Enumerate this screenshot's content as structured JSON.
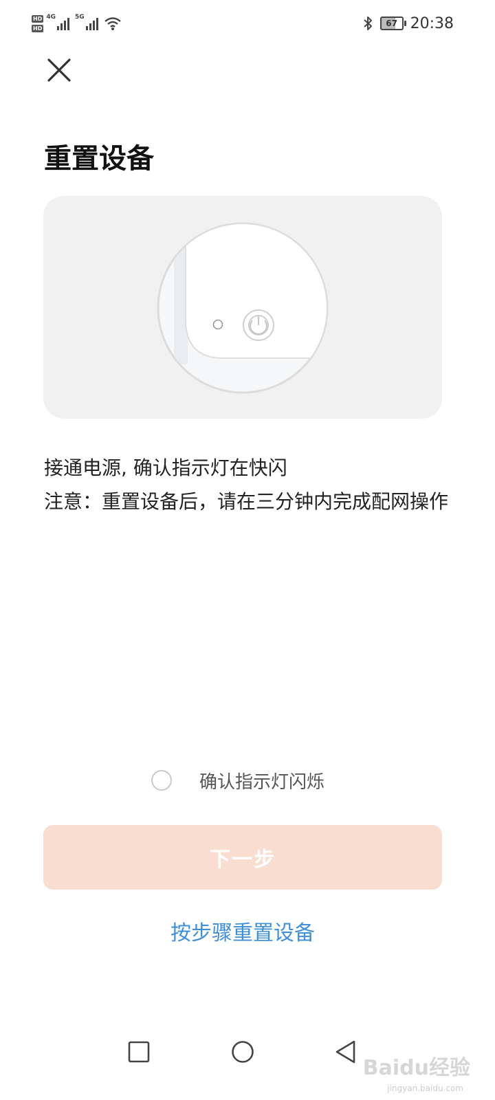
{
  "status_bar": {
    "hd1": "HD",
    "hd2": "HD",
    "net1": "4G",
    "net2": "5G",
    "battery": "67",
    "time": "20:38"
  },
  "page": {
    "title": "重置设备",
    "close_icon": "close-icon"
  },
  "instructions": {
    "line1": "接通电源, 确认指示灯在快闪",
    "line2": "注意：重置设备后，请在三分钟内完成配网操作"
  },
  "confirm": {
    "label": "确认指示灯闪烁",
    "checked": false
  },
  "next_button": {
    "label": "下一步",
    "enabled": false
  },
  "link": {
    "label": "按步骤重置设备"
  },
  "watermark": {
    "text": "Baidu经验",
    "sub": "jingyan.baidu.com"
  },
  "colors": {
    "accent_disabled": "#f9ddd1",
    "link": "#3f8fd9",
    "illustration_bg": "#f1f1f1"
  }
}
